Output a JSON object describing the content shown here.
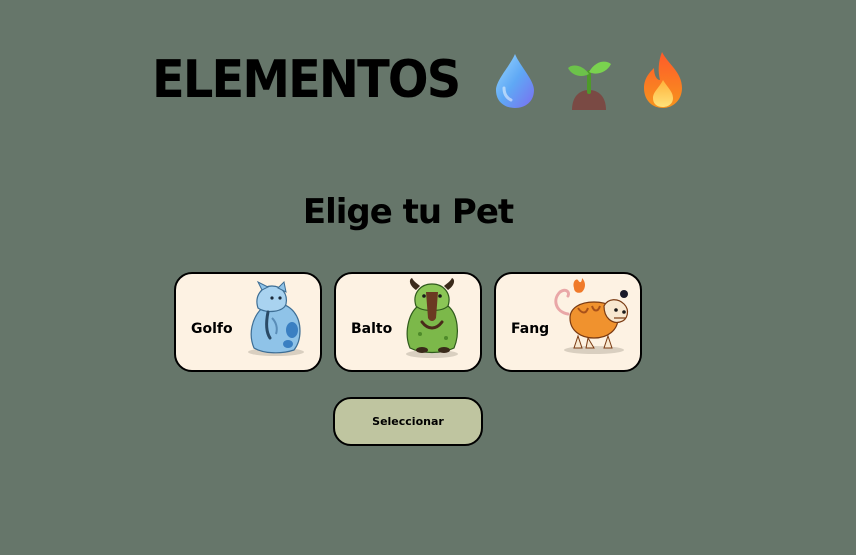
{
  "header": {
    "title": "ELEMENTOS",
    "element_icons": [
      "water-drop-icon",
      "seedling-icon",
      "fire-icon"
    ]
  },
  "main": {
    "subtitle": "Elige tu Pet",
    "pets": [
      {
        "name": "Golfo",
        "image": "golfo-pet-image"
      },
      {
        "name": "Balto",
        "image": "balto-pet-image"
      },
      {
        "name": "Fang",
        "image": "fang-pet-image"
      }
    ],
    "select_label": "Seleccionar"
  },
  "colors": {
    "background": "#66766a",
    "card": "#fdf2e3",
    "button": "#bfc5a0"
  }
}
